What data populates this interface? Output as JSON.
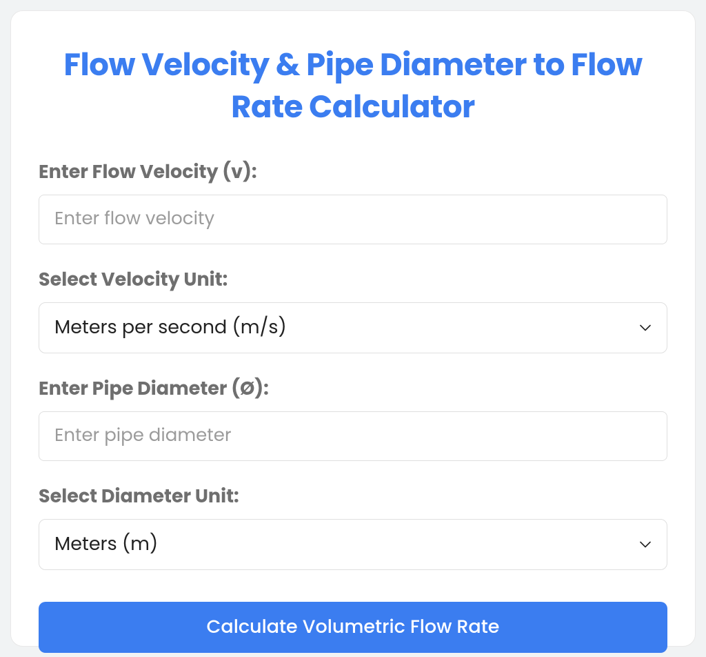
{
  "title": "Flow Velocity & Pipe Diameter to Flow Rate Calculator",
  "fields": {
    "velocity": {
      "label": "Enter Flow Velocity (v):",
      "placeholder": "Enter flow velocity"
    },
    "velocityUnit": {
      "label": "Select Velocity Unit:",
      "selected": "Meters per second (m/s)"
    },
    "diameter": {
      "label": "Enter Pipe Diameter (Ø):",
      "placeholder": "Enter pipe diameter"
    },
    "diameterUnit": {
      "label": "Select Diameter Unit:",
      "selected": "Meters (m)"
    }
  },
  "button": {
    "label": "Calculate Volumetric Flow Rate"
  }
}
